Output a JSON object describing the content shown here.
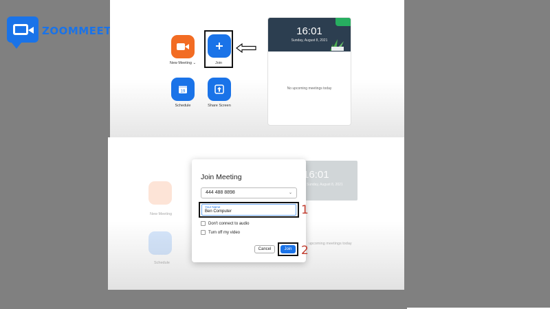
{
  "logo": {
    "text": "ZOOMMEETING"
  },
  "home": {
    "tiles": [
      {
        "label": "New Meeting  ⌄",
        "icon": "video-camera-icon",
        "color": "#f26c23"
      },
      {
        "label": "Join",
        "icon": "plus-icon",
        "color": "#1a73e8"
      },
      {
        "label": "Schedule",
        "icon": "calendar-icon",
        "color": "#1a73e8",
        "glyph": "19"
      },
      {
        "label": "Share Screen",
        "icon": "share-up-arrow-icon",
        "color": "#1a73e8"
      }
    ],
    "clock": {
      "time": "16:01",
      "date": "Sunday, August 8, 2021"
    },
    "no_meetings": "No upcoming meetings today"
  },
  "background_faded": {
    "time": "16:01",
    "date": "Sunday, August 8, 2021",
    "new_meeting": "New Meeting",
    "schedule": "Schedule",
    "no_meetings": "upcoming meetings today"
  },
  "dialog": {
    "title": "Join Meeting",
    "meeting_id": "444 488 8898",
    "name_label": "Your Name",
    "name_value": "Ben Computer",
    "option_audio": "Don't connect to audio",
    "option_video": "Turn off my video",
    "cancel": "Cancel",
    "join": "Join"
  },
  "annotations": {
    "step1": "1",
    "step2": "2"
  }
}
